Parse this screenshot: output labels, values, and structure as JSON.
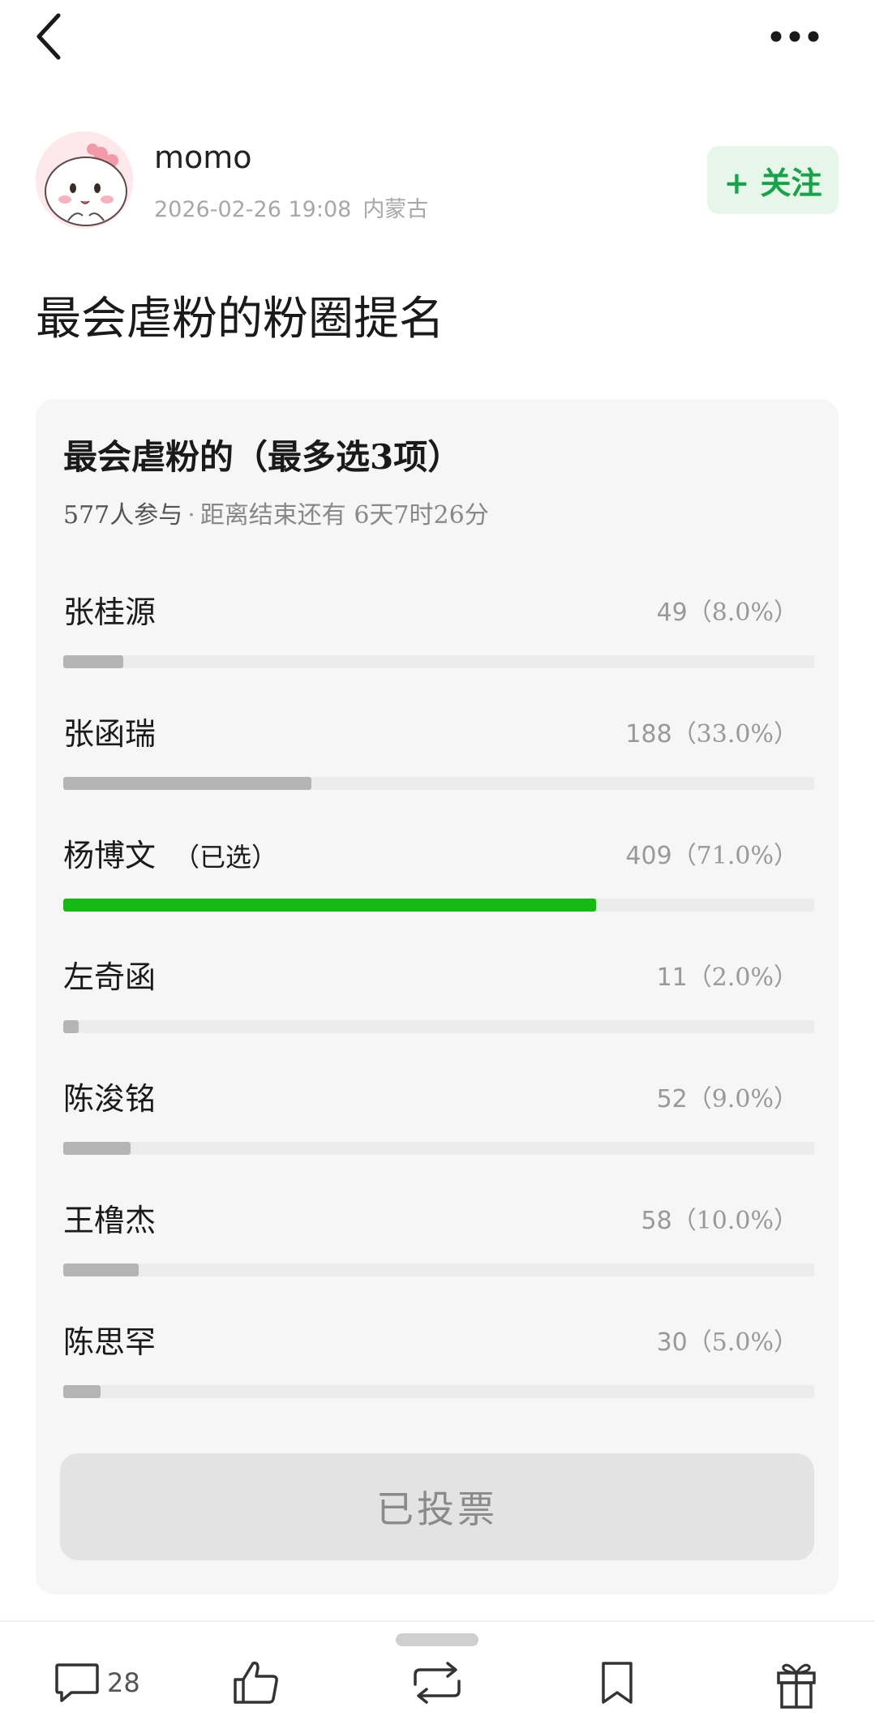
{
  "header": {
    "back_icon": "chevron-left-icon",
    "more_icon": "more-horizontal-icon"
  },
  "author": {
    "name": "momo",
    "datetime": "2026-02-26 19:08",
    "location": "内蒙古",
    "follow_label": "+ 关注"
  },
  "post": {
    "title": "最会虐粉的粉圈提名"
  },
  "poll": {
    "question": "最会虐粉的（最多选3项）",
    "participants": "577人参与",
    "separator": "·",
    "remaining": "距离结束还有 6天7时26分",
    "selected_mark": "（已选）",
    "options": [
      {
        "name": "张桂源",
        "count": "49",
        "percent_label": "（8.0%）",
        "percent": 8.0,
        "selected": false
      },
      {
        "name": "张函瑞",
        "count": "188",
        "percent_label": "（33.0%）",
        "percent": 33.0,
        "selected": false
      },
      {
        "name": "杨博文",
        "count": "409",
        "percent_label": "（71.0%）",
        "percent": 71.0,
        "selected": true
      },
      {
        "name": "左奇函",
        "count": "11",
        "percent_label": "（2.0%）",
        "percent": 2.0,
        "selected": false
      },
      {
        "name": "陈浚铭",
        "count": "52",
        "percent_label": "（9.0%）",
        "percent": 9.0,
        "selected": false
      },
      {
        "name": "王橹杰",
        "count": "58",
        "percent_label": "（10.0%）",
        "percent": 10.0,
        "selected": false
      },
      {
        "name": "陈思罕",
        "count": "30",
        "percent_label": "（5.0%）",
        "percent": 5.0,
        "selected": false
      }
    ],
    "voted_label": "已投票"
  },
  "bottom_bar": {
    "comment_count": "28",
    "icons": [
      "comment-icon",
      "like-icon",
      "repost-icon",
      "bookmark-icon",
      "gift-icon"
    ]
  },
  "colors": {
    "accent_green": "#16b816",
    "follow_green": "#17a34a",
    "follow_bg": "#e6f7e9",
    "bar_gray": "#b4b4b4"
  }
}
